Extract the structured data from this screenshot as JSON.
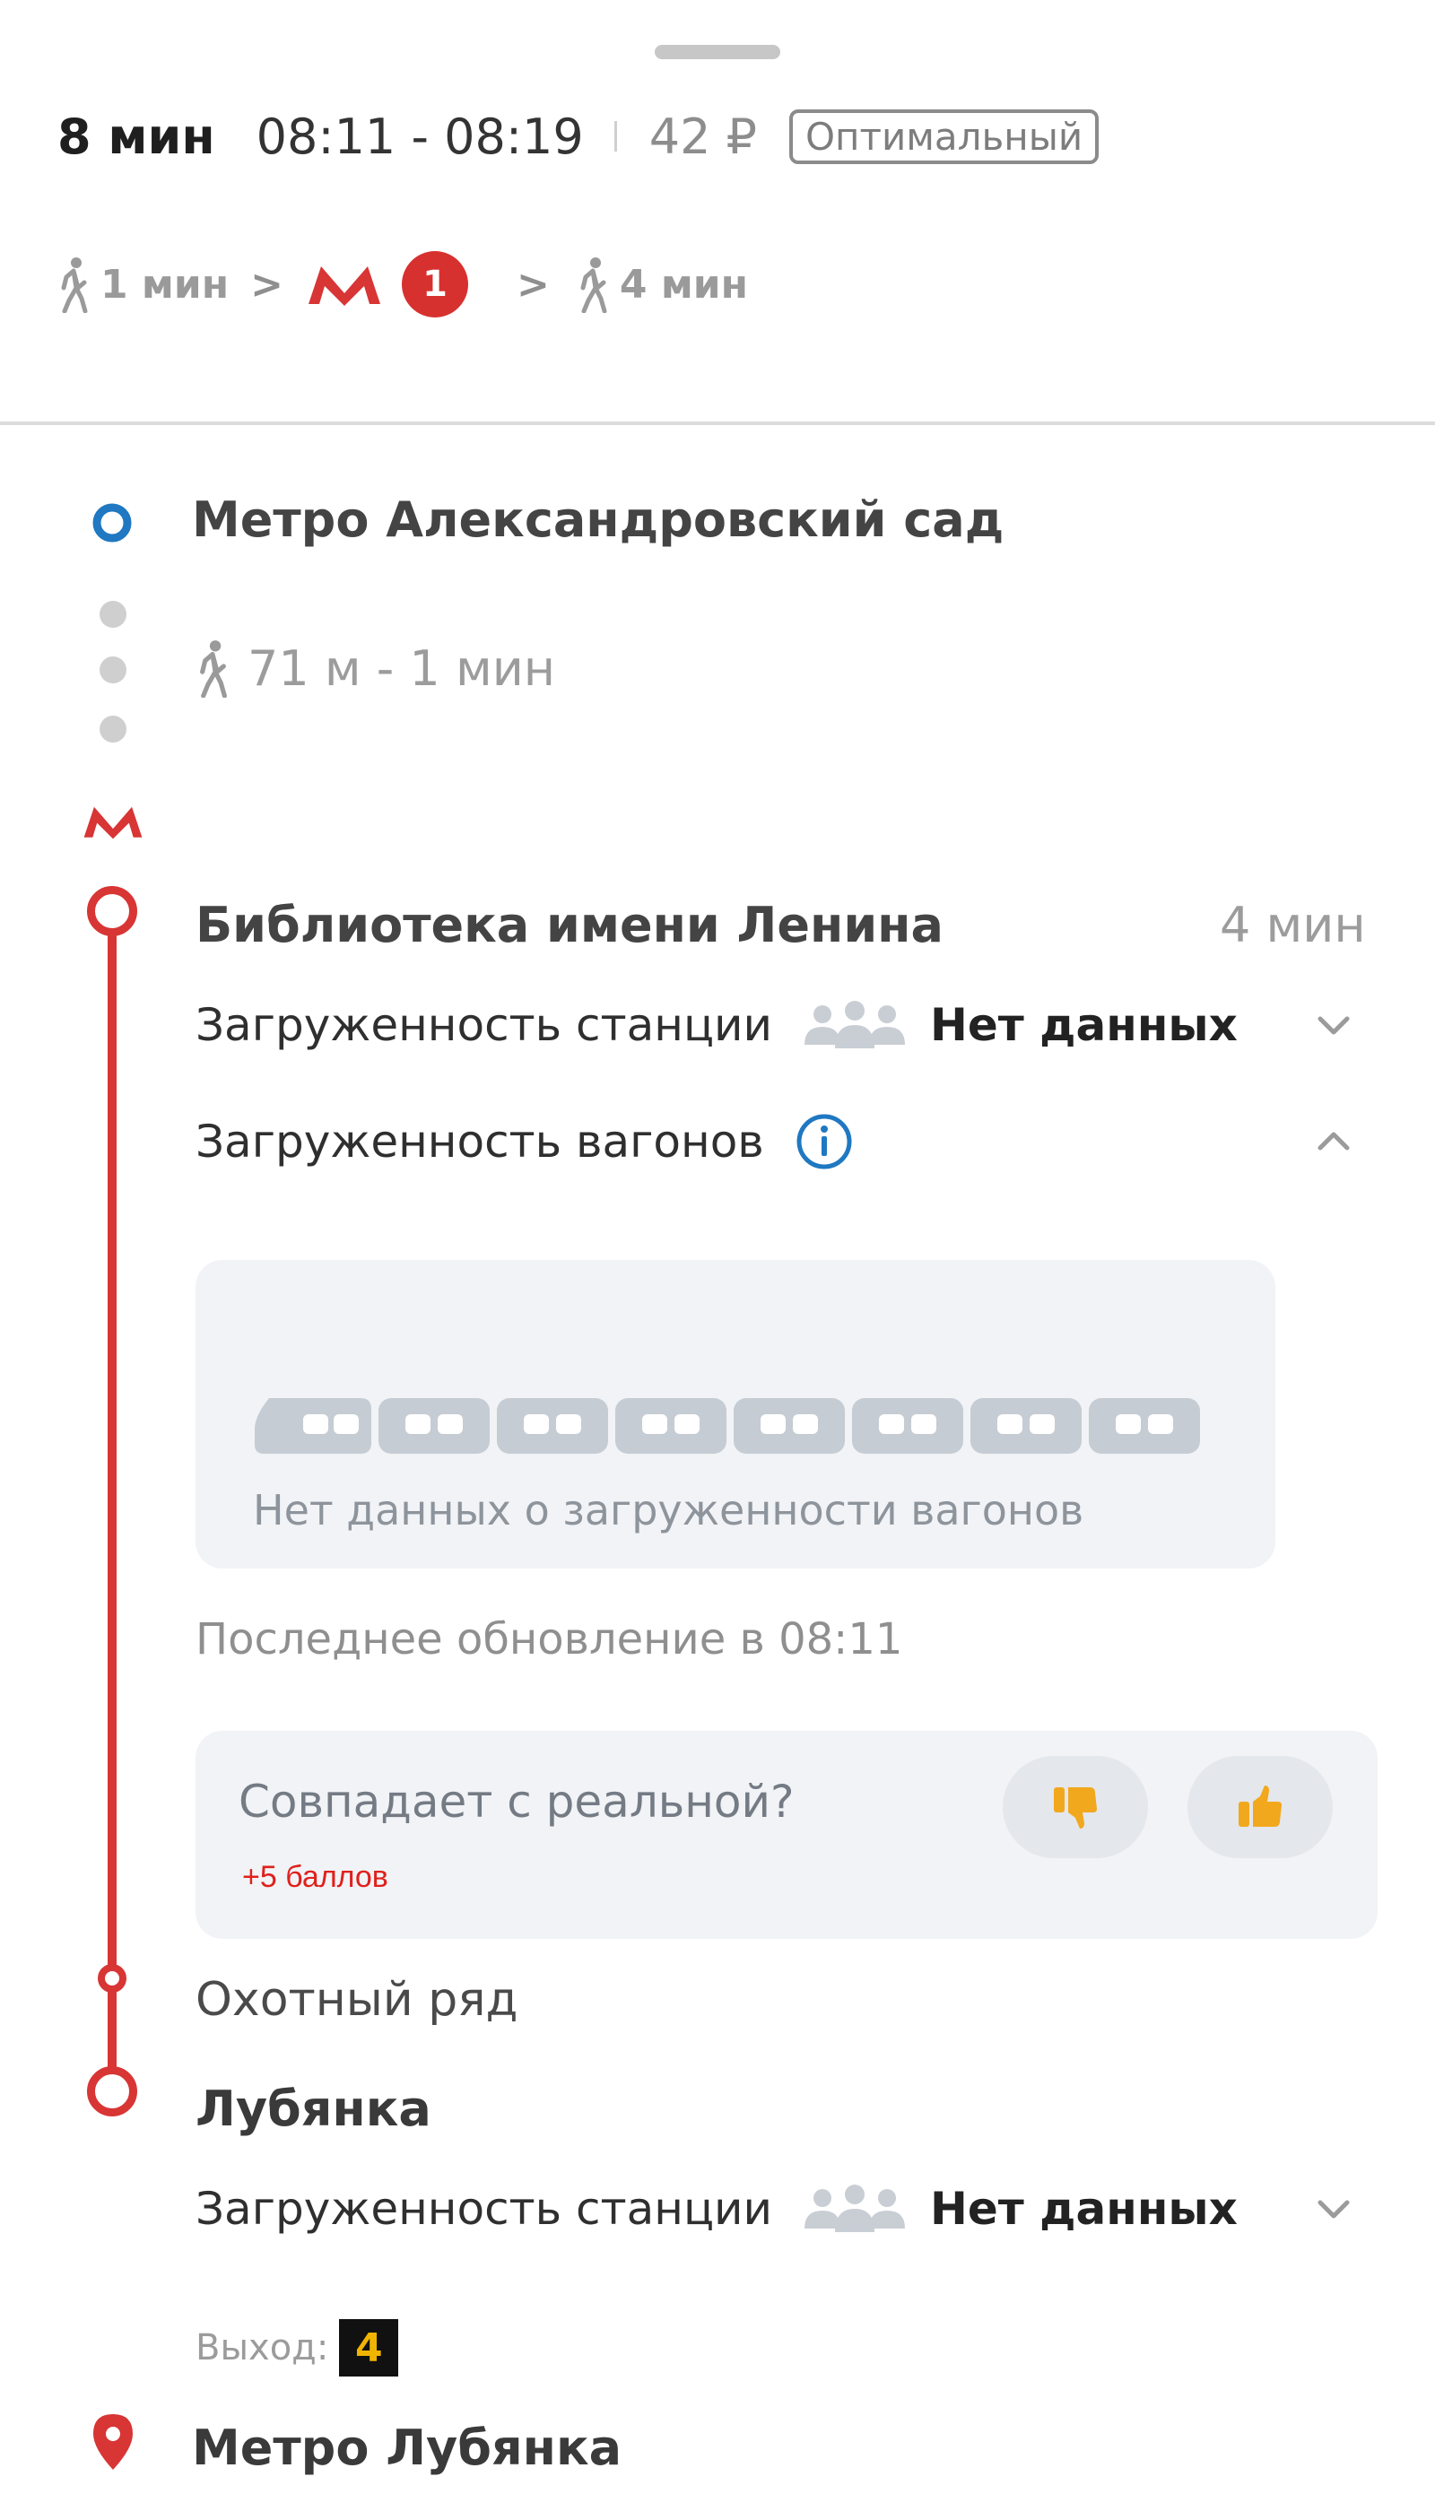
{
  "header": {
    "duration": "8 мин",
    "time_range": "08:11 - 08:19",
    "price": "42 ₽",
    "badge": "Оптимальный"
  },
  "summary": {
    "walk_start": "1 мин",
    "metro_line_number": "1",
    "walk_end": "4 мин"
  },
  "route": {
    "start_point": "Метро Александровский сад",
    "walk": "71 м - 1 мин",
    "board_station": {
      "name": "Библиотека имени Ленина",
      "ride_time": "4 мин",
      "station_load_label": "Загруженность станции",
      "station_load_value": "Нет данных",
      "car_load_label": "Загруженность вагонов",
      "car_load_empty": "Нет данных о загруженности вагонов",
      "last_update": "Последнее обновление в 08:11",
      "feedback_question": "Совпадает с реальной?",
      "feedback_bonus": "+5 баллов"
    },
    "intermediate_station": "Охотный ряд",
    "exit_station": {
      "name": "Лубянка",
      "station_load_label": "Загруженность станции",
      "station_load_value": "Нет данных",
      "exit_label": "Выход:",
      "exit_number": "4"
    },
    "end_point": "Метро Лубянка"
  },
  "colors": {
    "metro_red": "#d83535",
    "start_blue": "#1f78c1",
    "info_blue": "#1f78c1",
    "bonus_red": "#e0201c",
    "exit_badge_bg": "#111111",
    "exit_badge_text": "#f0b400"
  }
}
